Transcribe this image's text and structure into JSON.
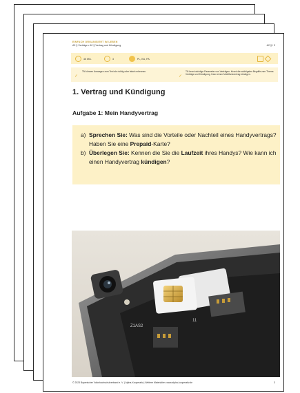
{
  "header": {
    "tag": "EINFACH ORGANISIERT IM LEBEN",
    "subtitle": "A2 § Verträge • A2 § Vertrag und Kündigung",
    "page_ref": "A2 § / 3"
  },
  "infobar": {
    "duration": "45 Min.",
    "count": "3",
    "social_form": "PL, EA, PA"
  },
  "goals": {
    "left": "TN können Aussagen zum Text als richtig oder falsch erkennen.",
    "right": "TN kennt wichtige Parameter von Verträgen. Kennt die wichtigsten Begriffe zum Thema Verträge und Kündigung. Kann einen Mobilfunkvertrag kündigen."
  },
  "section_title": "1. Vertrag und Kündigung",
  "exercise_title": "Aufgabe 1: Mein Handyvertrag",
  "tasks": [
    {
      "label": "a)",
      "bold1": "Sprechen Sie:",
      "text1": " Was sind die Vorteile oder Nachteil eines Handyvertrags? Haben Sie eine ",
      "bold2": "Prepaid",
      "text2": "-Karte?"
    },
    {
      "label": "b)",
      "bold1": "Überlegen Sie:",
      "text1": " Kennen die Sie die ",
      "bold2": "Laufzeit",
      "text2": " ihres Handys? Wie kann ich einen Handyvertrag ",
      "bold3": "kündigen",
      "text3": "?"
    }
  ],
  "photo": {
    "chip_labels": [
      "Z1AS2",
      "11"
    ]
  },
  "footer": {
    "text": "© 2023 Bayerischer Volkshochschulverband e. V. | Alpha-Kooperativ | Weitere Materialien: www.alpha-kooperativ.de",
    "page_number": "3"
  },
  "colors": {
    "accent": "#f1c34c",
    "box_bg": "#fdf1c7"
  }
}
